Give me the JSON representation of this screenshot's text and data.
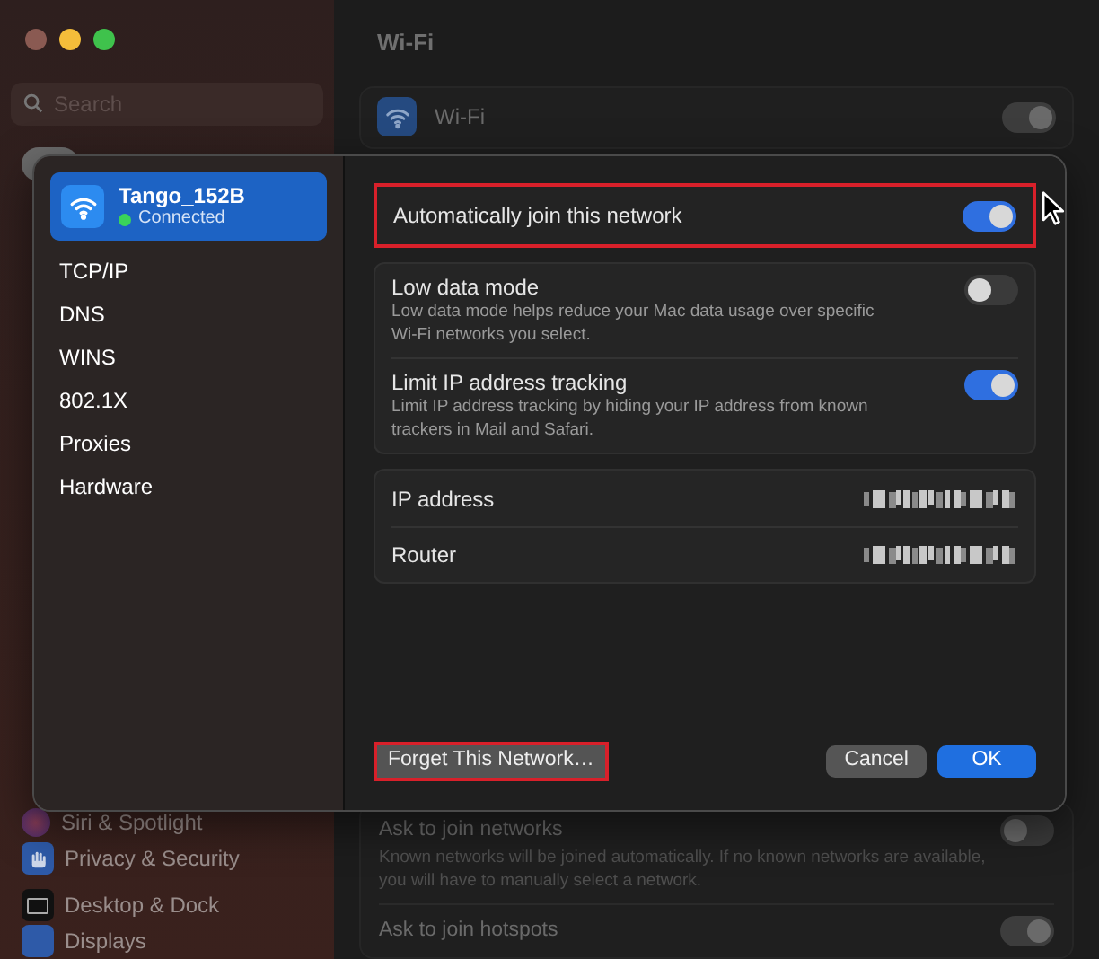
{
  "window": {
    "title": "Wi-Fi"
  },
  "sidebar": {
    "search": {
      "placeholder": "Search"
    },
    "items": [
      {
        "label": "Siri & Spotlight",
        "kind": "siri"
      },
      {
        "label": "Privacy & Security",
        "kind": "privacy"
      },
      {
        "label": "Desktop & Dock",
        "kind": "desktop"
      },
      {
        "label": "Displays",
        "kind": "displays"
      }
    ]
  },
  "wifi_row": {
    "label": "Wi-Fi",
    "on": true
  },
  "settings": [
    {
      "label": "Ask to join networks",
      "description": "Known networks will be joined automatically. If no known networks are available, you will have to manually select a network.",
      "on": false
    },
    {
      "label": "Ask to join hotspots",
      "on": true
    }
  ],
  "sheet": {
    "network": {
      "name": "Tango_152B",
      "status": "Connected",
      "selected": true
    },
    "tabs": [
      {
        "label": "TCP/IP",
        "selected": false
      },
      {
        "label": "DNS",
        "selected": false
      },
      {
        "label": "WINS",
        "selected": false
      },
      {
        "label": "802.1X",
        "selected": false
      },
      {
        "label": "Proxies",
        "selected": false
      },
      {
        "label": "Hardware",
        "selected": false
      }
    ],
    "auto_join": {
      "label": "Automatically join this network",
      "on": true,
      "highlighted": true
    },
    "options": [
      {
        "label": "Low data mode",
        "description": "Low data mode helps reduce your Mac data usage over specific Wi-Fi networks you select.",
        "on": false
      },
      {
        "label": "Limit IP address tracking",
        "description": "Limit IP address tracking by hiding your IP address from known trackers in Mail and Safari.",
        "on": true
      }
    ],
    "info": [
      {
        "label": "IP address"
      },
      {
        "label": "Router"
      }
    ],
    "forget_button": {
      "label": "Forget This Network…",
      "highlighted": true
    },
    "cancel_button": {
      "label": "Cancel"
    },
    "ok_button": {
      "label": "OK"
    }
  }
}
